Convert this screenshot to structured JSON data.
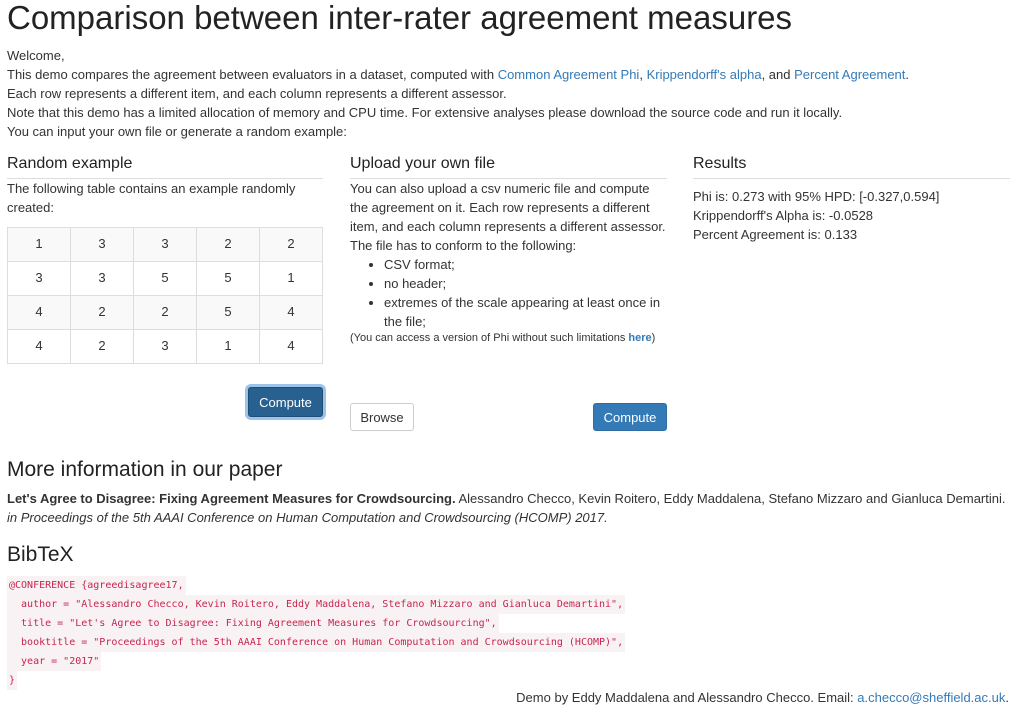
{
  "page": {
    "title": "Comparison between inter-rater agreement measures"
  },
  "intro": {
    "welcome": "Welcome,",
    "line1_prefix": "This demo compares the agreement between evaluators in a dataset, computed with",
    "link_phi": "Common Agreement Phi",
    "sep1": ",",
    "link_alpha": "Krippendorff's alpha",
    "sep2": ", and",
    "link_percent": "Percent Agreement",
    "line1_suffix": ".",
    "line2": "Each row represents a different item, and each column represents a different assessor.",
    "line3": "Note that this demo has a limited allocation of memory and CPU time. For extensive analyses please download the source code and run it locally.",
    "line4": "You can input your own file or generate a random example:"
  },
  "random_example": {
    "heading": "Random example",
    "description": "The following table contains an example randomly created:",
    "table": [
      [
        "1",
        "3",
        "3",
        "2",
        "2"
      ],
      [
        "3",
        "3",
        "5",
        "5",
        "1"
      ],
      [
        "4",
        "2",
        "2",
        "5",
        "4"
      ],
      [
        "4",
        "2",
        "3",
        "1",
        "4"
      ]
    ],
    "compute_label": "Compute"
  },
  "upload": {
    "heading": "Upload your own file",
    "description": "You can also upload a csv numeric file and compute the agreement on it. Each row represents a different item, and each column represents a different assessor.",
    "conform_text": "The file has to conform to the following:",
    "rules": [
      "CSV format;",
      "no header;",
      "extremes of the scale appearing at least once in the file;"
    ],
    "note_prefix": "(You can access a version of Phi without such limitations",
    "note_link": "here",
    "note_suffix": ")",
    "browse_label": "Browse",
    "compute_label": "Compute"
  },
  "results": {
    "heading": "Results",
    "phi": "Phi is: 0.273 with 95% HPD: [-0.327,0.594]",
    "alpha": "Krippendorff's Alpha is: -0.0528",
    "percent": "Percent Agreement is: 0.133"
  },
  "paper": {
    "heading": "More information in our paper",
    "title": "Let's Agree to Disagree: Fixing Agreement Measures for Crowdsourcing.",
    "authors": "Alessandro Checco, Kevin Roitero, Eddy Maddalena, Stefano Mizzaro and Gianluca Demartini.",
    "venue": "in Proceedings of the 5th AAAI Conference on Human Computation and Crowdsourcing (HCOMP) 2017."
  },
  "bibtex": {
    "heading": "BibTeX",
    "lines": [
      "@CONFERENCE {agreedisagree17,",
      "  author = \"Alessandro Checco, Kevin Roitero, Eddy Maddalena, Stefano Mizzaro and Gianluca Demartini\",",
      "  title = \"Let's Agree to Disagree: Fixing Agreement Measures for Crowdsourcing\",",
      "  booktitle = \"Proceedings of the 5th AAAI Conference on Human Computation and Crowdsourcing (HCOMP)\",",
      "  year = \"2017\"",
      "}"
    ]
  },
  "footer": {
    "text": "Demo by Eddy Maddalena and Alessandro Checco. Email:",
    "email": "a.checco@sheffield.ac.uk",
    "end": "."
  },
  "colors": {
    "link": "#337ab7",
    "primary_button": "#337ab7",
    "code_text": "#c7254e",
    "code_background": "#f9f2f4"
  }
}
